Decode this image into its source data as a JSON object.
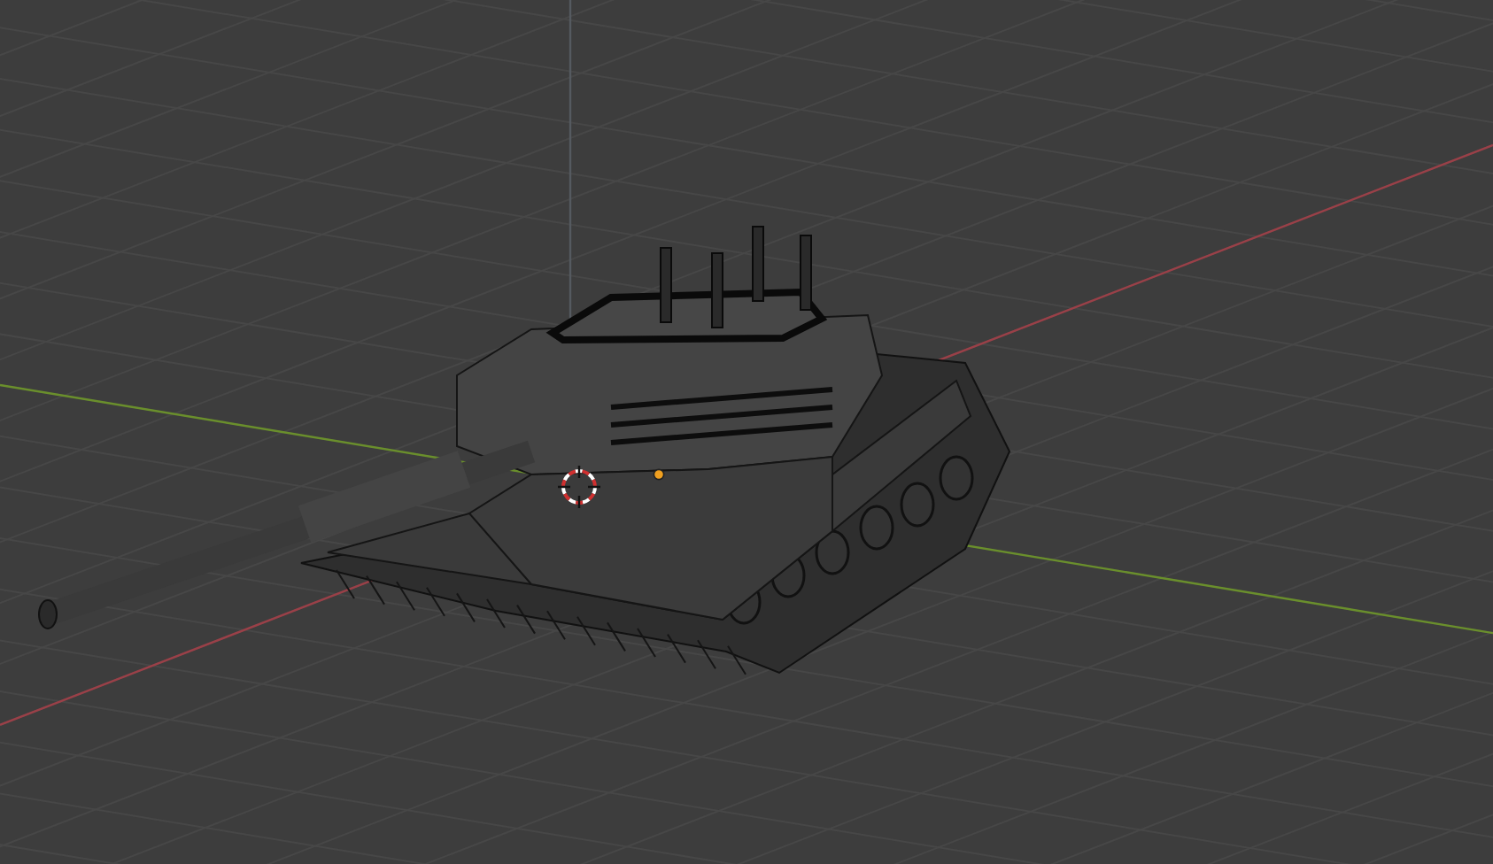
{
  "viewport": {
    "axes": [
      {
        "kind": "x",
        "color": "#9a4048"
      },
      {
        "kind": "y",
        "color": "#6a8f2c"
      },
      {
        "kind": "z",
        "color": "#555a60"
      }
    ]
  }
}
